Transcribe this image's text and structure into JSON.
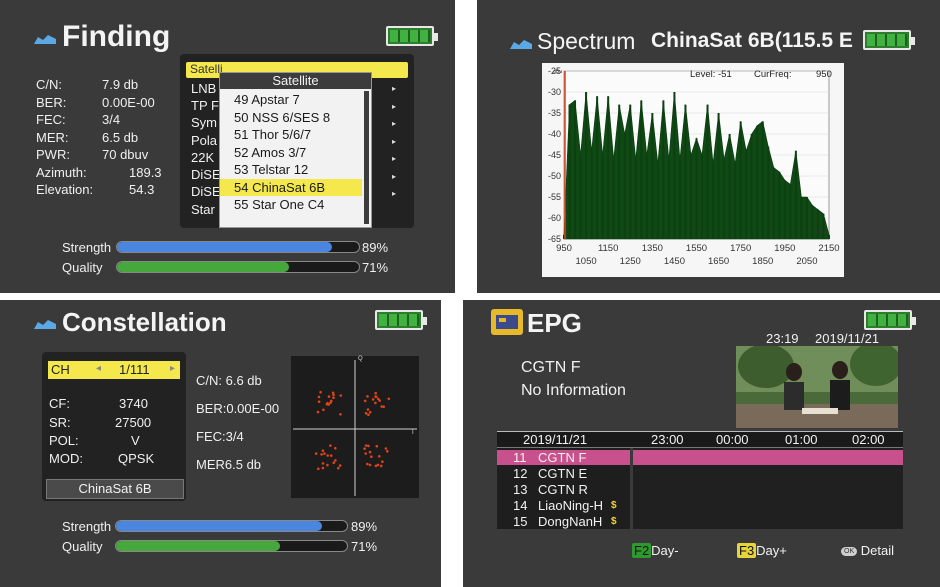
{
  "finding": {
    "title": "Finding",
    "stats": [
      {
        "label": "C/N:",
        "value": "7.9 db"
      },
      {
        "label": "BER:",
        "value": "0.00E-00"
      },
      {
        "label": "FEC:",
        "value": "3/4"
      },
      {
        "label": "MER:",
        "value": "6.5 db"
      },
      {
        "label": "PWR:",
        "value": "70 dbuv"
      },
      {
        "label": "Azimuth:",
        "value": "189.3"
      },
      {
        "label": "Elevation:",
        "value": "54.3"
      }
    ],
    "menu_items": [
      "LNB",
      "TP F",
      "Sym",
      "Pola",
      "22K",
      "DiSE",
      "DiSE",
      "Star"
    ],
    "menu_header": "Satelli",
    "popup_title": "Satellite",
    "popup_items": [
      "49 Apstar 7",
      "50 NSS 6/SES 8",
      "51 Thor 5/6/7",
      "52 Amos 3/7",
      "53 Telstar 12",
      "54 ChinaSat 6B",
      "55 Star One C4"
    ],
    "popup_selected_index": 5,
    "strength_label": "Strength",
    "strength_value": "89%",
    "strength_fraction": 0.89,
    "quality_label": "Quality",
    "quality_value": "71%",
    "quality_fraction": 0.71
  },
  "spectrum": {
    "title": "Spectrum",
    "satellite": "ChinaSat 6B(115.5 E",
    "level_label": "Level:",
    "level_value": "-51",
    "curfreq_label": "CurFreq:",
    "curfreq_value": "950",
    "y_unit": "dBu",
    "x_unit": "MHz",
    "y_ticks": [
      "-25",
      "-30",
      "-35",
      "-40",
      "-45",
      "-50",
      "-55",
      "-60",
      "-65"
    ],
    "x_ticks_top": [
      "950",
      "1150",
      "1350",
      "1550",
      "1750",
      "1950",
      "2150"
    ],
    "x_ticks_bottom": [
      "1050",
      "1250",
      "1450",
      "1650",
      "1850",
      "2050"
    ]
  },
  "chart_data": {
    "type": "area",
    "title": "",
    "xlabel": "MHz",
    "ylabel": "dBu",
    "xlim": [
      950,
      2150
    ],
    "ylim": [
      -65,
      -25
    ],
    "x": [
      950,
      975,
      1000,
      1025,
      1050,
      1075,
      1100,
      1125,
      1150,
      1175,
      1200,
      1225,
      1250,
      1275,
      1300,
      1325,
      1350,
      1375,
      1400,
      1425,
      1450,
      1475,
      1500,
      1525,
      1550,
      1575,
      1600,
      1625,
      1650,
      1675,
      1700,
      1725,
      1750,
      1775,
      1800,
      1825,
      1850,
      1875,
      1900,
      1925,
      1950,
      1975,
      2000,
      2025,
      2050,
      2075,
      2100,
      2125,
      2150
    ],
    "values": [
      -64,
      -33,
      -32,
      -45,
      -30,
      -44,
      -31,
      -45,
      -31,
      -46,
      -33,
      -40,
      -33,
      -46,
      -32,
      -45,
      -35,
      -47,
      -32,
      -46,
      -30,
      -46,
      -33,
      -45,
      -41,
      -45,
      -33,
      -47,
      -35,
      -46,
      -40,
      -47,
      -37,
      -44,
      -40,
      -38,
      -37,
      -43,
      -48,
      -49,
      -51,
      -52,
      -44,
      -55,
      -55,
      -57,
      -58,
      -59,
      -64
    ]
  },
  "constellation": {
    "title": "Constellation",
    "ch_label": "CH",
    "ch_value": "1/111",
    "params": [
      {
        "label": "CF:",
        "value": "3740"
      },
      {
        "label": "SR:",
        "value": "27500"
      },
      {
        "label": "POL:",
        "value": "V"
      },
      {
        "label": "MOD:",
        "value": "QPSK"
      }
    ],
    "satellite": "ChinaSat 6B",
    "cn": "C/N: 6.6 db",
    "ber": "BER:0.00E-00",
    "fec": "FEC:3/4",
    "mer": "MER6.5 db",
    "axis_q": "Q",
    "axis_i": "I",
    "strength_label": "Strength",
    "strength_value": "89%",
    "strength_fraction": 0.89,
    "quality_label": "Quality",
    "quality_value": "71%",
    "quality_fraction": 0.71
  },
  "epg": {
    "title": "EPG",
    "time": "23:19",
    "date": "2019/11/21",
    "channel_name": "CGTN F",
    "info": "No Information",
    "grid_date": "2019/11/21",
    "time_slots": [
      "23:00",
      "00:00",
      "01:00",
      "02:00"
    ],
    "channels": [
      {
        "num": "11",
        "name": "CGTN F",
        "badge": ""
      },
      {
        "num": "12",
        "name": "CGTN E",
        "badge": ""
      },
      {
        "num": "13",
        "name": "CGTN R",
        "badge": ""
      },
      {
        "num": "14",
        "name": "LiaoNing-H",
        "badge": "$"
      },
      {
        "num": "15",
        "name": "DongNanH",
        "badge": "$"
      }
    ],
    "f2_key": "F2",
    "f2_label": "Day-",
    "f3_key": "F3",
    "f3_label": "Day+",
    "ok_key": "OK",
    "ok_label": "Detail"
  },
  "colors": {
    "panel_bg": "#3a3a3a",
    "strength_bar": "#4a86e0",
    "quality_bar": "#46a83c",
    "highlight_yellow": "#f4e84c",
    "spectrum_fill": "#0f4a14",
    "constellation_dot": "#e0431a",
    "epg_selected": "#c8508c"
  }
}
